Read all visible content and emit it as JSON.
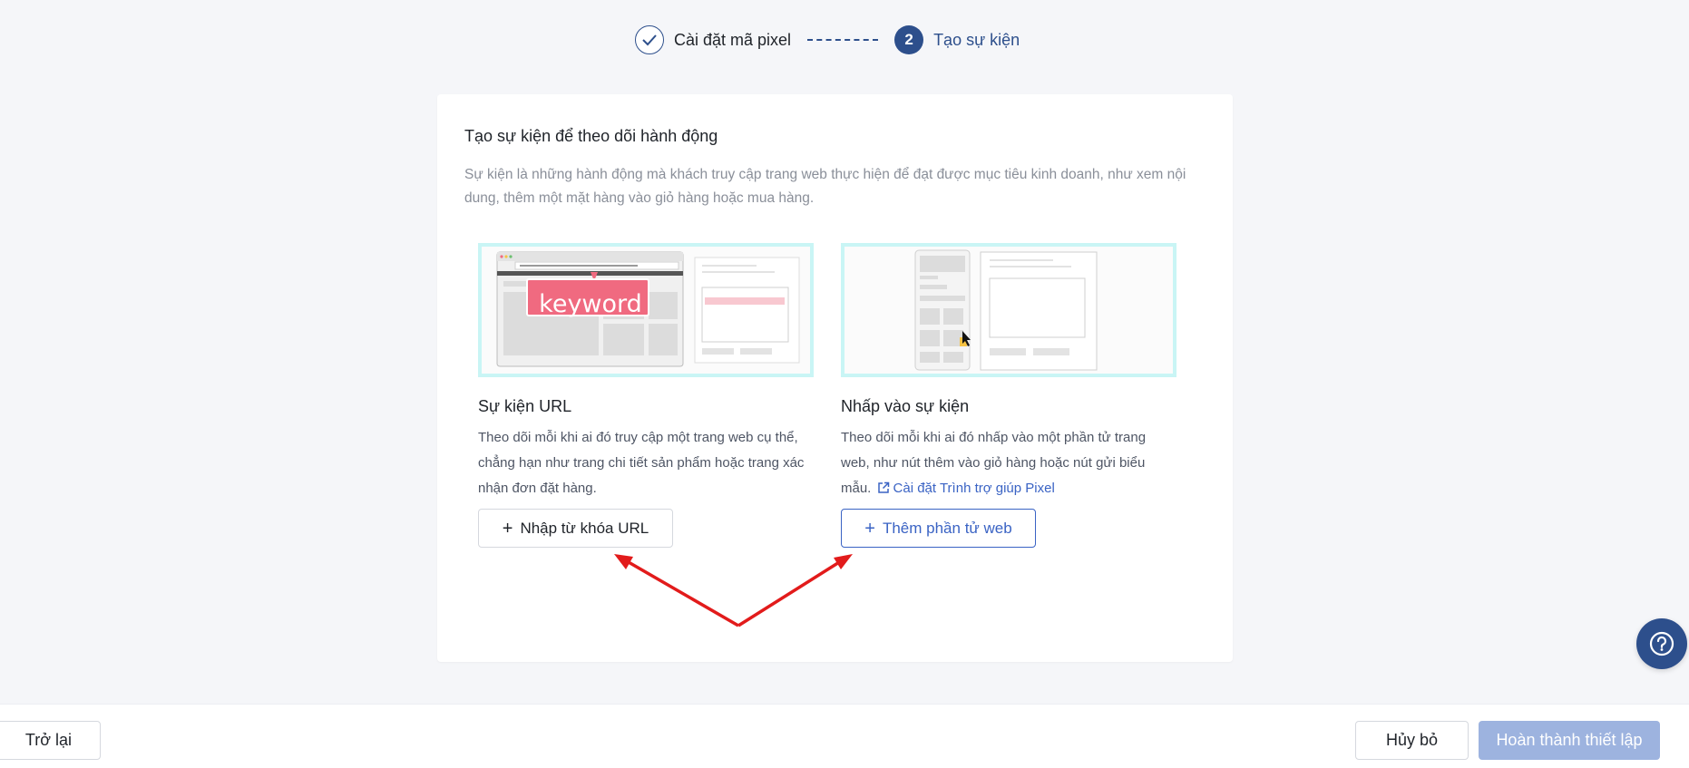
{
  "stepper": {
    "step1_label": "Cài đặt mã pixel",
    "step2_number": "2",
    "step2_label": "Tạo sự kiện"
  },
  "card": {
    "title": "Tạo sự kiện để theo dõi hành động",
    "description": "Sự kiện là những hành động mà khách truy cập trang web thực hiện để đạt được mục tiêu kinh doanh, như xem nội dung, thêm một mặt hàng vào giỏ hàng hoặc mua hàng."
  },
  "url_event": {
    "illustration_keyword": "keyword",
    "title": "Sự kiện URL",
    "description": "Theo dõi mỗi khi ai đó truy cập một trang web cụ thể, chẳng hạn như trang chi tiết sản phẩm hoặc trang xác nhận đơn đặt hàng.",
    "button_label": "Nhập từ khóa URL"
  },
  "click_event": {
    "title": "Nhấp vào sự kiện",
    "description": "Theo dõi mỗi khi ai đó nhấp vào một phần tử trang web, như nút thêm vào giỏ hàng hoặc nút gửi biểu mẫu.",
    "link_label": "Cài đặt Trình trợ giúp Pixel",
    "button_label": "Thêm phần tử web"
  },
  "footer": {
    "back_label": "Trở lại",
    "cancel_label": "Hủy bỏ",
    "finish_label": "Hoàn thành thiết lập"
  },
  "colors": {
    "primary": "#2d4f8c",
    "link": "#3a63c4",
    "disabled_primary": "#9db3df",
    "annotation_arrow": "#e21b1b",
    "illustration_border": "#c9f5f5",
    "keyword_badge": "#f06a80"
  },
  "icons": [
    "check-icon",
    "plus-icon",
    "external-link-icon",
    "help-icon",
    "cursor-icon"
  ]
}
